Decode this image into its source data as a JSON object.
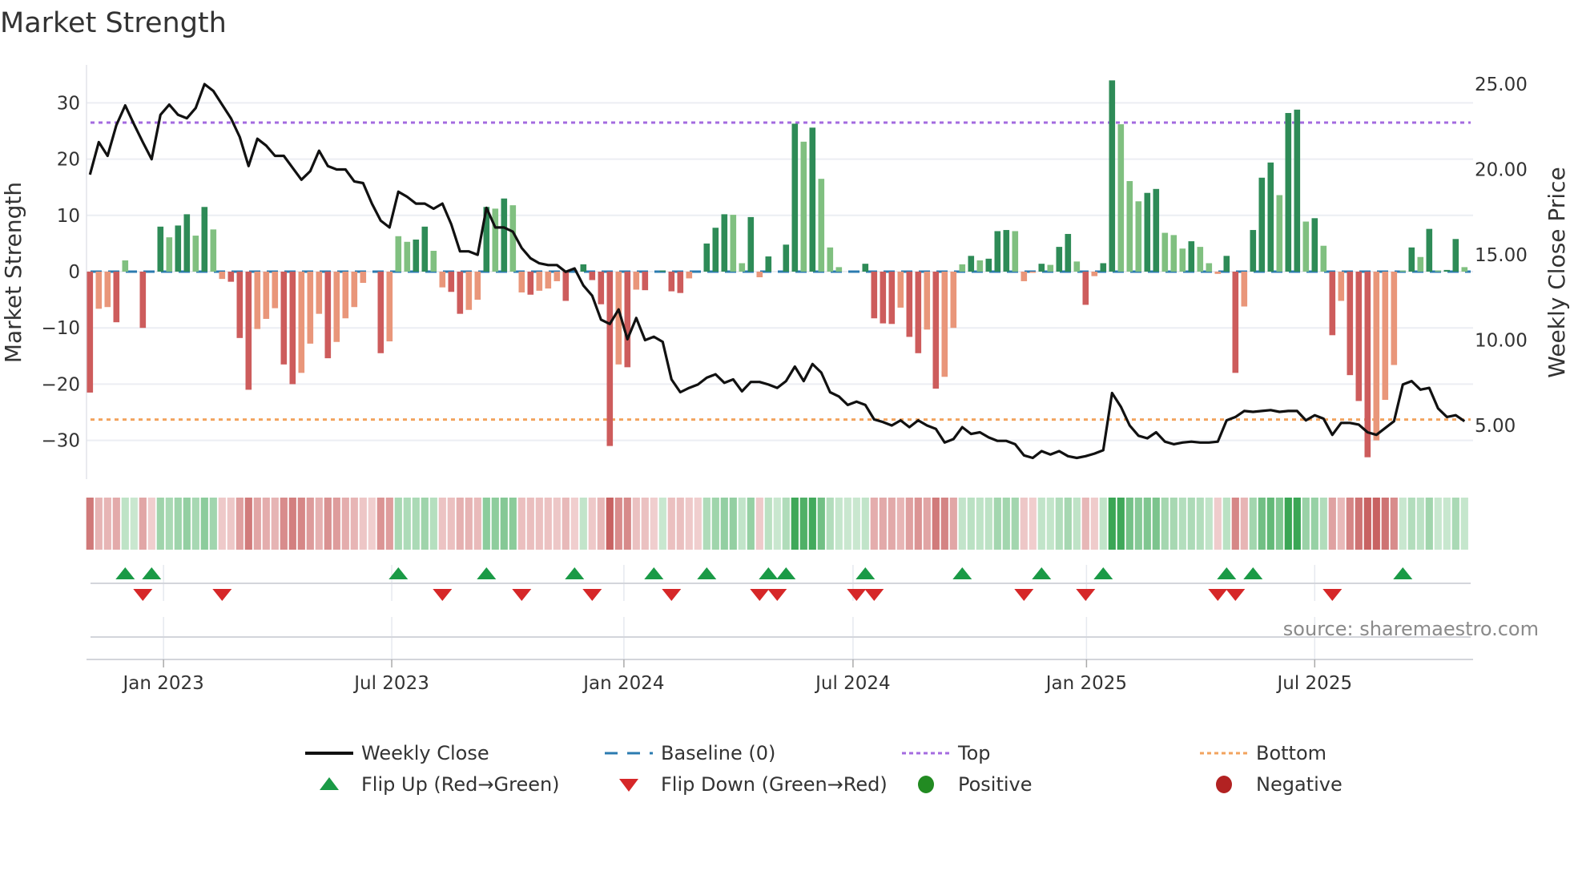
{
  "title": "Market Strength",
  "source": "source: sharemaestro.com",
  "chart_data": {
    "type": "bar+line",
    "title": "Market Strength",
    "x_unit": "week",
    "ylabel_left": "Market Strength",
    "ylabel_right": "Weekly Close Price",
    "ylim_left": [
      -35,
      35
    ],
    "ylim_right_ticks": [
      5,
      25
    ],
    "left_ticks": [
      {
        "v": 30,
        "label": "30"
      },
      {
        "v": 20,
        "label": "20"
      },
      {
        "v": 10,
        "label": "10"
      },
      {
        "v": 0,
        "label": "0"
      },
      {
        "v": -10,
        "label": "−10"
      },
      {
        "v": -20,
        "label": "−20"
      },
      {
        "v": -30,
        "label": "−30"
      }
    ],
    "right_ticks": [
      {
        "v": 25,
        "label": "25.00"
      },
      {
        "v": 20,
        "label": "20.00"
      },
      {
        "v": 15,
        "label": "15.00"
      },
      {
        "v": 10,
        "label": "10.00"
      },
      {
        "v": 5,
        "label": "5.00"
      }
    ],
    "x_ticks": [
      {
        "week": 8.35,
        "label": "Jan 2023"
      },
      {
        "week": 34.25,
        "label": "Jul 2023"
      },
      {
        "week": 60.6,
        "label": "Jan 2024"
      },
      {
        "week": 86.6,
        "label": "Jul 2024"
      },
      {
        "week": 113.1,
        "label": "Jan 2025"
      },
      {
        "week": 139,
        "label": "Jul 2025"
      }
    ],
    "top_level": 26.5,
    "bottom_level": -26.3,
    "strength": [
      -21.5,
      -6.6,
      -6.3,
      -9,
      2,
      0,
      -10,
      0,
      8,
      6.1,
      8.2,
      10.2,
      6.4,
      11.5,
      7.5,
      -1.3,
      -1.8,
      -11.8,
      -21,
      -10.2,
      -8.4,
      -6.5,
      -16.5,
      -20,
      -18,
      -12.8,
      -7.5,
      -15.4,
      -12.5,
      -8.3,
      -6.3,
      -2,
      0,
      -14.5,
      -12.4,
      6.3,
      5.3,
      5.7,
      8,
      3.7,
      -2.8,
      -3.6,
      -7.5,
      -6.8,
      -5,
      11.5,
      11.2,
      13,
      11.8,
      -3.7,
      -4.1,
      -3.4,
      -3,
      -1.7,
      -5.2,
      0,
      1.3,
      -1.5,
      -5.8,
      -31,
      -16.5,
      -17,
      -3.2,
      -3.3,
      0,
      0.2,
      -3.5,
      -3.8,
      -1.2,
      0,
      5,
      7.8,
      10.2,
      10.1,
      1.5,
      9.7,
      -1,
      2.7,
      0,
      4.8,
      26.3,
      23.1,
      25.6,
      16.5,
      4.3,
      0.8,
      0,
      0,
      1.4,
      -8.3,
      -9.2,
      -9.3,
      -6.4,
      -11.6,
      -14.5,
      -10.3,
      -20.8,
      -18.7,
      -10,
      1.3,
      2.8,
      2,
      2.3,
      7.2,
      7.4,
      7.2,
      -1.7,
      -0.2,
      1.4,
      1.2,
      4.4,
      6.7,
      1.8,
      -5.9,
      -0.8,
      1.5,
      34,
      26.2,
      16.1,
      12.5,
      14,
      14.7,
      6.9,
      6.5,
      4.1,
      5.4,
      4.4,
      1.5,
      -0.4,
      2.8,
      -18,
      -6.2,
      7.4,
      16.7,
      19.4,
      13.6,
      28.2,
      28.8,
      8.9,
      9.5,
      4.6,
      -11.3,
      -5.2,
      -18.4,
      -23,
      -33,
      -30,
      -22.8,
      -16.6,
      0.2,
      4.3,
      2.6,
      7.6,
      0.2,
      0.3,
      5.8,
      0.8
    ],
    "weekly_close": [
      19.7,
      21.6,
      20.8,
      22.6,
      23.75,
      22.65,
      21.6,
      20.6,
      23.2,
      23.8,
      23.2,
      23.0,
      23.6,
      25.0,
      24.6,
      23.8,
      23.0,
      21.9,
      20.2,
      21.8,
      21.4,
      20.8,
      20.8,
      20.1,
      19.4,
      19.9,
      21.1,
      20.2,
      20.0,
      20.0,
      19.3,
      19.2,
      18.0,
      17.0,
      16.6,
      18.7,
      18.4,
      18.0,
      18.0,
      17.7,
      18.0,
      16.8,
      15.2,
      15.2,
      15.0,
      17.75,
      16.6,
      16.6,
      16.35,
      15.4,
      14.8,
      14.5,
      14.4,
      14.4,
      14.0,
      14.2,
      13.2,
      12.6,
      11.2,
      10.95,
      11.8,
      10.05,
      11.3,
      10.0,
      10.2,
      9.9,
      7.7,
      6.95,
      7.2,
      7.4,
      7.8,
      8.0,
      7.5,
      7.7,
      7.0,
      7.55,
      7.55,
      7.4,
      7.2,
      7.6,
      8.45,
      7.6,
      8.6,
      8.1,
      6.95,
      6.7,
      6.2,
      6.4,
      6.2,
      5.35,
      5.2,
      5.0,
      5.3,
      4.9,
      5.3,
      5.0,
      4.8,
      4.0,
      4.2,
      4.9,
      4.5,
      4.6,
      4.3,
      4.1,
      4.1,
      3.9,
      3.25,
      3.1,
      3.5,
      3.3,
      3.5,
      3.2,
      3.1,
      3.2,
      3.35,
      3.55,
      6.9,
      6.1,
      5.0,
      4.4,
      4.25,
      4.6,
      4.05,
      3.9,
      4.0,
      4.05,
      4.0,
      4.0,
      4.05,
      5.3,
      5.5,
      5.85,
      5.8,
      5.85,
      5.9,
      5.8,
      5.85,
      5.85,
      5.3,
      5.6,
      5.4,
      4.45,
      5.15,
      5.15,
      5.05,
      4.6,
      4.45,
      4.85,
      5.25,
      7.4,
      7.6,
      7.1,
      7.2,
      6.0,
      5.5,
      5.6,
      5.25
    ],
    "flip_up_weeks": [
      5,
      8,
      36,
      46,
      56,
      65,
      71,
      78,
      80,
      89,
      100,
      109,
      116,
      130,
      133,
      150
    ],
    "flip_down_weeks": [
      7,
      16,
      41,
      50,
      58,
      67,
      77,
      79,
      88,
      90,
      107,
      114,
      129,
      131,
      142
    ],
    "legend_placement": "bottom-center",
    "legend": [
      {
        "label": "Weekly Close",
        "kind": "line",
        "color": "#111111"
      },
      {
        "label": "Baseline (0)",
        "kind": "dash",
        "color": "#2b7bb0"
      },
      {
        "label": "Top",
        "kind": "dot",
        "color": "#a46be0"
      },
      {
        "label": "Bottom",
        "kind": "dot",
        "color": "#f2a35e"
      },
      {
        "label": "Flip Up (Red→Green)",
        "kind": "up",
        "color": "#1a9a46"
      },
      {
        "label": "Flip Down (Green→Red)",
        "kind": "down",
        "color": "#d62728"
      },
      {
        "label": "Positive",
        "kind": "dot-marker",
        "color": "#228b22"
      },
      {
        "label": "Negative",
        "kind": "dot-marker",
        "color": "#b22222"
      }
    ]
  },
  "colors": {
    "pos_strong": "#2e8b57",
    "pos_weak": "#80c080",
    "neg_strong": "#cd5c5c",
    "neg_weak": "#e9967a",
    "top": "#a46be0",
    "bottom": "#f2a35e",
    "baseline": "#2b7bb0",
    "price": "#111111",
    "grid": "#eceef3"
  }
}
